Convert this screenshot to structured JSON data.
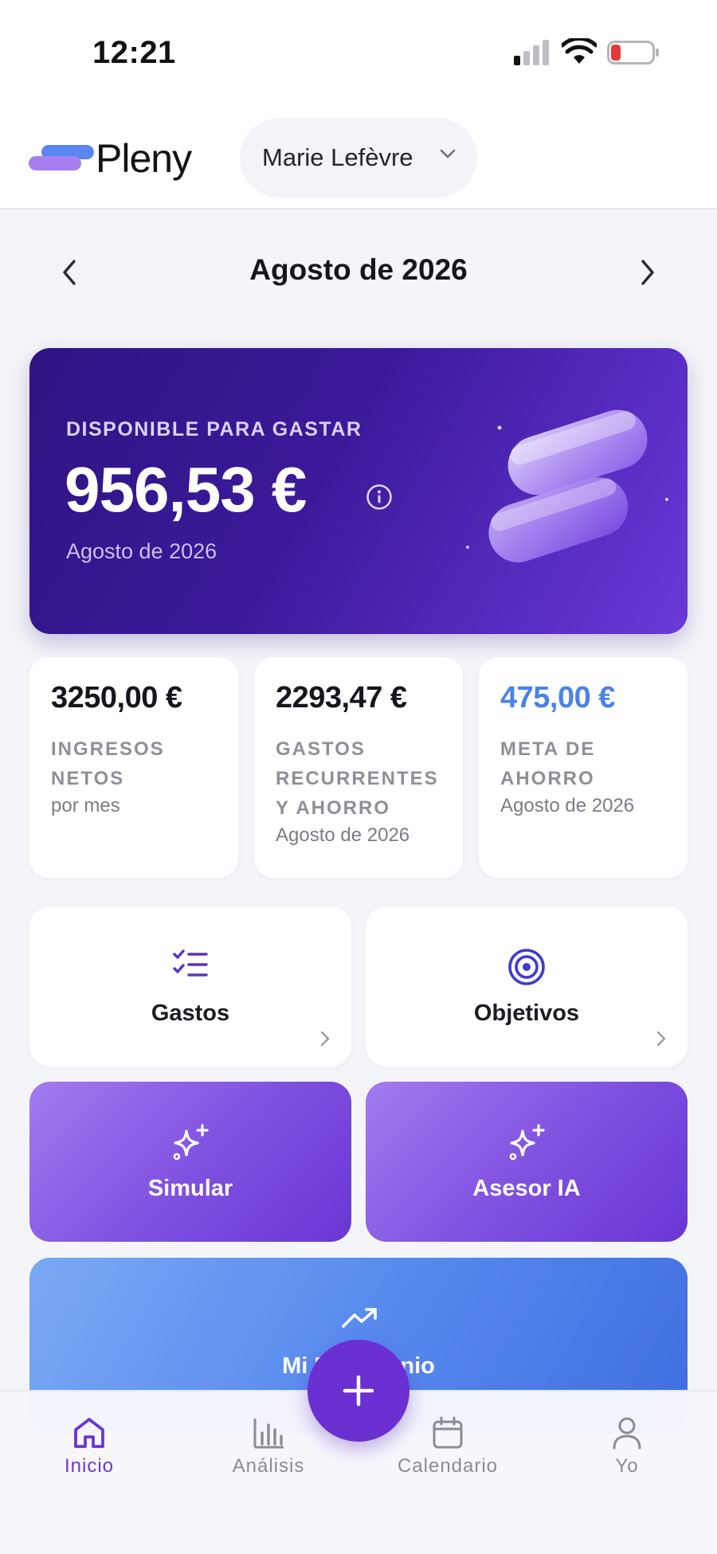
{
  "status_bar": {
    "time": "12:21"
  },
  "header": {
    "brand": "Pleny",
    "user_name": "Marie Lefèvre"
  },
  "month_nav": {
    "title": "Agosto de 2026"
  },
  "hero": {
    "label": "DISPONIBLE PARA GASTAR",
    "amount": "956,53 €",
    "period": "Agosto de 2026"
  },
  "stats": [
    {
      "value": "3250,00 €",
      "caption_lines": [
        "INGRESOS",
        "NETOS"
      ],
      "sub": "por mes"
    },
    {
      "value": "2293,47 €",
      "caption_lines": [
        "GASTOS",
        "RECURRENTES",
        "Y AHORRO"
      ],
      "sub": "Agosto de 2026"
    },
    {
      "value": "475,00 €",
      "caption_lines": [
        "META DE",
        "AHORRO"
      ],
      "sub": "Agosto de 2026",
      "accent": "#4b82e6"
    }
  ],
  "tiles": {
    "gastos": {
      "label": "Gastos",
      "icon": "checklist-icon"
    },
    "objetivos": {
      "label": "Objetivos",
      "icon": "target-icon"
    },
    "simular": {
      "label": "Simular",
      "icon": "sparkles-icon"
    },
    "asesor": {
      "label": "Asesor IA",
      "icon": "sparkles-icon"
    },
    "patrimonio": {
      "label": "Mi Patrimonio",
      "icon": "trending-up-icon"
    }
  },
  "bottom_nav": {
    "items": [
      {
        "label": "Inicio",
        "icon": "home-icon",
        "active": true
      },
      {
        "label": "Análisis",
        "icon": "bar-chart-icon"
      },
      {
        "label": "Calendario",
        "icon": "calendar-icon"
      },
      {
        "label": "Yo",
        "icon": "user-icon"
      }
    ],
    "fab_icon": "plus-icon"
  },
  "colors": {
    "primary": "#6a36d4",
    "accent_blue": "#4b82e6",
    "hero_bg": "#3b1a9a"
  }
}
